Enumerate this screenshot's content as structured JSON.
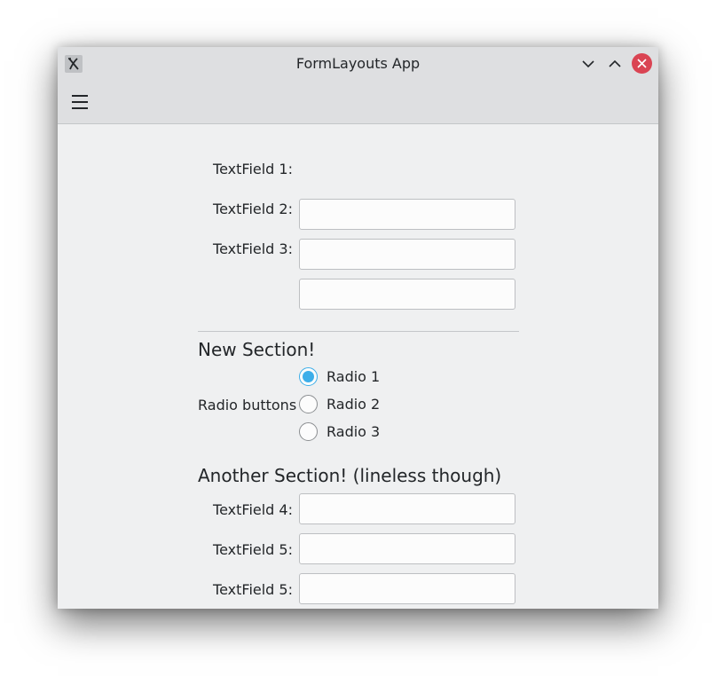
{
  "window": {
    "title": "FormLayouts App",
    "close_color": "#da4453",
    "accent_color": "#3daee9"
  },
  "toolbar": {
    "menu_icon": "hamburger-menu-icon"
  },
  "form": {
    "section1": [
      {
        "label": "TextField 1:",
        "value": ""
      },
      {
        "label": "TextField 2:",
        "value": ""
      },
      {
        "label": "TextField 3:",
        "value": ""
      }
    ],
    "section2": {
      "title": "New Section!",
      "radio_group_label": "Radio buttons",
      "radios": [
        {
          "label": "Radio 1",
          "checked": true
        },
        {
          "label": "Radio 2",
          "checked": false
        },
        {
          "label": "Radio 3",
          "checked": false
        }
      ]
    },
    "section3": {
      "title": "Another Section! (lineless though)",
      "fields": [
        {
          "label": "TextField 4:",
          "value": ""
        },
        {
          "label": "TextField 5:",
          "value": ""
        },
        {
          "label": "TextField 5:",
          "value": ""
        }
      ]
    }
  }
}
